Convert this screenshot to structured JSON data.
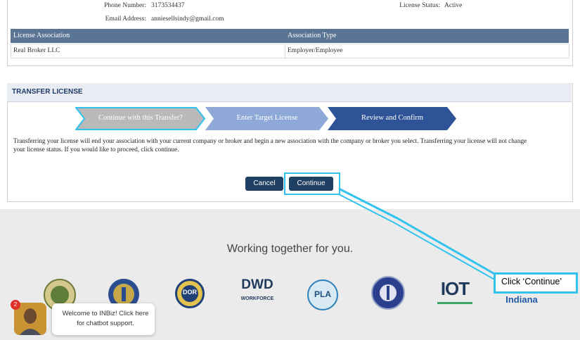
{
  "contact": {
    "phone_label": "Phone Number:",
    "phone_value": "3173534437",
    "email_label": "Email Address:",
    "email_value": "anniesellsindy@gmail.com",
    "status_label": "License Status:",
    "status_value": "Active"
  },
  "association_table": {
    "headers": [
      "License Association",
      "Association Type"
    ],
    "rows": [
      [
        "Real Broker LLC",
        "Employer/Employee"
      ]
    ]
  },
  "transfer": {
    "title": "TRANSFER LICENSE",
    "steps": [
      "Continue with this Transfer?",
      "Enter Target License",
      "Review and Confirm"
    ],
    "description": "Transferring your license will end your association with your current company or broker and begin a new association with the company or broker you select. Transferring your license will not change your license status. If you would like to proceed, click continue.",
    "cancel_label": "Cancel",
    "continue_label": "Continue"
  },
  "footer": {
    "heading": "Working together for you.",
    "logo_texts": {
      "dor": "DOR",
      "dwd": "DWD",
      "dwd_sub": "WORKFORCE",
      "pla": "PLA",
      "iot": "IOT",
      "indiana": "Indiana"
    }
  },
  "annotation": {
    "callout_text": "Click ‘Continue’"
  },
  "chatbot": {
    "message": "Welcome to INBiz! Click here for chatbot support.",
    "badge_count": "2"
  },
  "colors": {
    "header_bar": "#5a7493",
    "button_navy": "#1f3f63",
    "highlight_cyan": "#33c2ee",
    "step_active": "#b9b9b9",
    "step_mid": "#8ea9d8",
    "step_dark": "#2e5396"
  }
}
